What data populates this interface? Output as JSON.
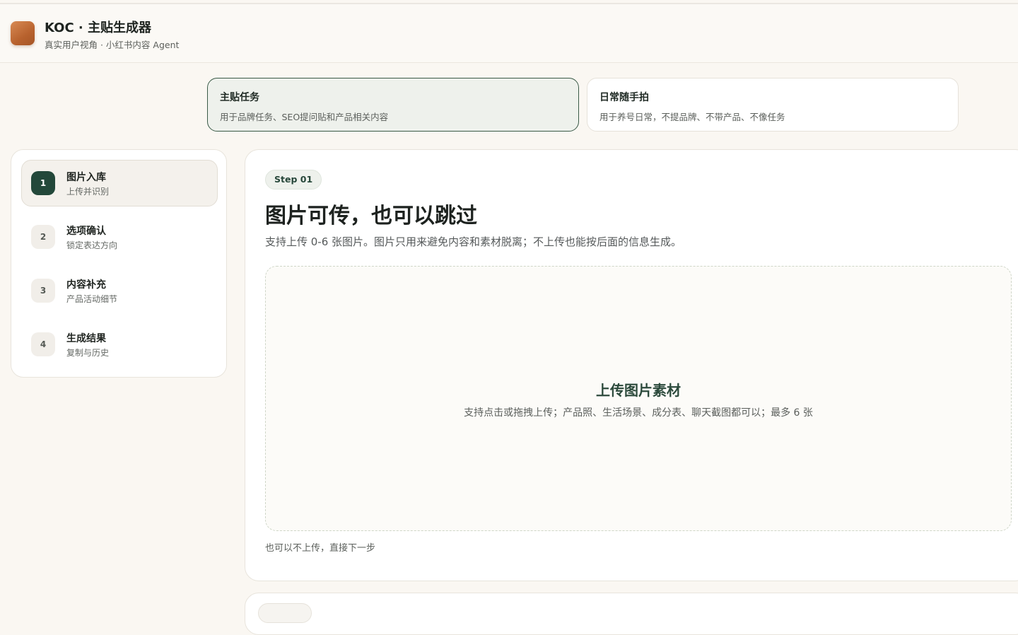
{
  "app": {
    "title": "KOC · 主贴生成器",
    "subtitle": "真实用户视角 · 小红书内容 Agent",
    "logo_icon": "app-logo-square"
  },
  "modes": [
    {
      "title": "主贴任务",
      "description": "用于品牌任务、SEO提问贴和产品相关内容",
      "selected": true
    },
    {
      "title": "日常随手拍",
      "description": "用于养号日常，不提品牌、不带产品、不像任务",
      "selected": false
    }
  ],
  "steps": [
    {
      "number": "1",
      "name": "图片入库",
      "description": "上传并识别",
      "active": true
    },
    {
      "number": "2",
      "name": "选项确认",
      "description": "锁定表达方向",
      "active": false
    },
    {
      "number": "3",
      "name": "内容补充",
      "description": "产品活动细节",
      "active": false
    },
    {
      "number": "4",
      "name": "生成结果",
      "description": "复制与历史",
      "active": false
    }
  ],
  "main": {
    "step_badge": "Step 01",
    "title": "图片可传，也可以跳过",
    "description": "支持上传 0-6 张图片。图片只用来避免内容和素材脱离；不上传也能按后面的信息生成。",
    "upload": {
      "title": "上传图片素材",
      "description": "支持点击或拖拽上传；产品照、生活场景、成分表、聊天截图都可以；最多 6 张"
    },
    "skip_hint": "也可以不上传，直接下一步"
  },
  "colors": {
    "accent_dark_green": "#23483a",
    "active_card_bg": "#eef1ec",
    "page_bg": "#faf7f2",
    "logo_orange": "#c36b36"
  }
}
